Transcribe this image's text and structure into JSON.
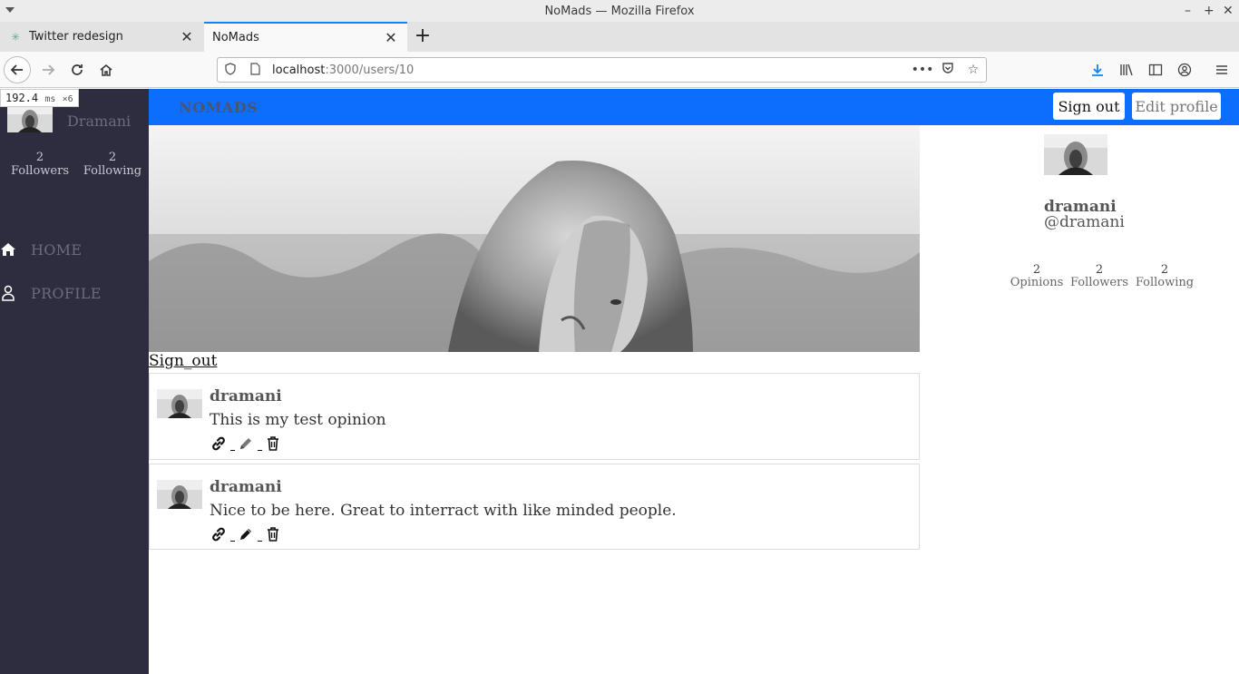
{
  "window": {
    "title": "NoMads — Mozilla Firefox"
  },
  "tabs": [
    {
      "label": "Twitter redesign",
      "active": false
    },
    {
      "label": "NoMads",
      "active": true
    }
  ],
  "address_bar": {
    "host": "localhost",
    "path": ":3000/users/10"
  },
  "perf_badge": {
    "value": "192.4",
    "unit": "ms",
    "multiplier": "×6"
  },
  "sidebar": {
    "user_name": "Dramani",
    "stats": [
      {
        "count": "2",
        "label": "Followers"
      },
      {
        "count": "2",
        "label": "Following"
      }
    ],
    "nav": [
      {
        "label": "HOME",
        "icon": "home-icon"
      },
      {
        "label": "PROFILE",
        "icon": "user-icon"
      }
    ]
  },
  "topbar": {
    "brand": "NOMADS",
    "sign_out_label": "Sign out",
    "edit_profile_label": "Edit profile",
    "color": "#0d6efd"
  },
  "main": {
    "sign_out_link": "Sign_out",
    "opinions": [
      {
        "author": "dramani",
        "text": "This is my test opinion"
      },
      {
        "author": "dramani",
        "text": "Nice to be here. Great to interract with like minded people."
      }
    ]
  },
  "profile_panel": {
    "name": "dramani",
    "handle": "@dramani",
    "stats": [
      {
        "count": "2",
        "label": "Opinions"
      },
      {
        "count": "2",
        "label": "Followers"
      },
      {
        "count": "2",
        "label": "Following"
      }
    ]
  },
  "colors": {
    "sidebar_bg": "#2e2d3f",
    "accent": "#0a84ff"
  }
}
